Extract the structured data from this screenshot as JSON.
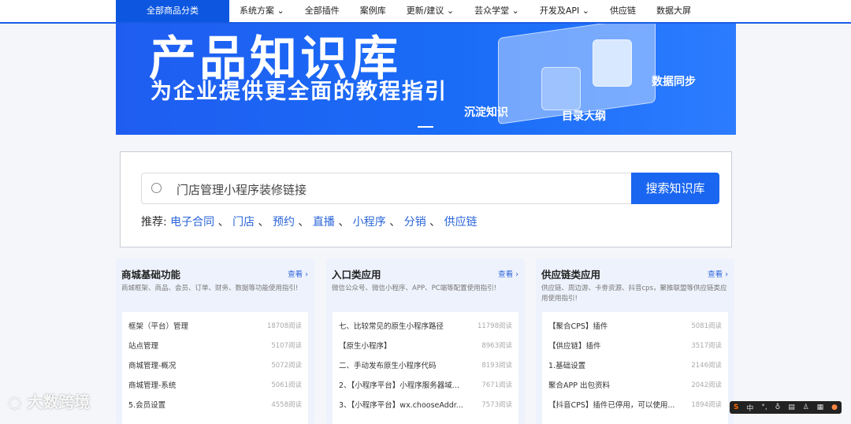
{
  "nav": {
    "category": "全部商品分类",
    "items": [
      "系统方案 ⌄",
      "全部插件",
      "案例库",
      "更新/建议 ⌄",
      "芸众学堂 ⌄",
      "开发及API ⌄",
      "供应链",
      "数据大屏"
    ]
  },
  "banner": {
    "title": "产品知识库",
    "subtitle": "为企业提供更全面的教程指引",
    "labels": [
      "沉淀知识",
      "目录大纲",
      "数据同步"
    ]
  },
  "search": {
    "value": "门店管理小程序装修链接",
    "button": "搜索知识库",
    "rec_label": "推荐:",
    "tags": [
      "电子合同",
      "门店",
      "预约",
      "直播",
      "小程序",
      "分销",
      "供应链"
    ]
  },
  "cards": [
    {
      "title": "商城基础功能",
      "more": "查看 ›",
      "desc": "商城框架、商品、会员、订单、财务、数据等功能使用指引!",
      "rows": [
        [
          "框架（平台）管理",
          "18708阅读"
        ],
        [
          "站点管理",
          "5107阅读"
        ],
        [
          "商城管理-概况",
          "5072阅读"
        ],
        [
          "商城管理-系统",
          "5061阅读"
        ],
        [
          "5.会员设置",
          "4558阅读"
        ]
      ]
    },
    {
      "title": "入口类应用",
      "more": "查看 ›",
      "desc": "微信公众号、微信小程序、APP、PC端等配置使用指引!",
      "rows": [
        [
          "七、比较常见的原生小程序路径",
          "11798阅读"
        ],
        [
          "【原生小程序】",
          "8963阅读"
        ],
        [
          "二、手动发布原生小程序代码",
          "8193阅读"
        ],
        [
          "2、【小程序平台】小程序服务器域...",
          "7671阅读"
        ],
        [
          "3、【小程序平台】wx.chooseAddr...",
          "7573阅读"
        ]
      ]
    },
    {
      "title": "供应链类应用",
      "more": "查看 ›",
      "desc": "供应链、周边游、卡劵资源、抖音cps，聚推联盟等供应链类应用使用指引!",
      "rows": [
        [
          "【聚合CPS】插件",
          "5081阅读"
        ],
        [
          "【供应链】插件",
          "3517阅读"
        ],
        [
          "1.基础设置",
          "2146阅读"
        ],
        [
          "聚合APP 出包资料",
          "2042阅读"
        ],
        [
          "【抖音CPS】插件已停用，可以使用...",
          "1894阅读"
        ]
      ]
    }
  ],
  "watermark": "大数跨境",
  "ime": {
    "logo": "S",
    "lang": "中"
  }
}
